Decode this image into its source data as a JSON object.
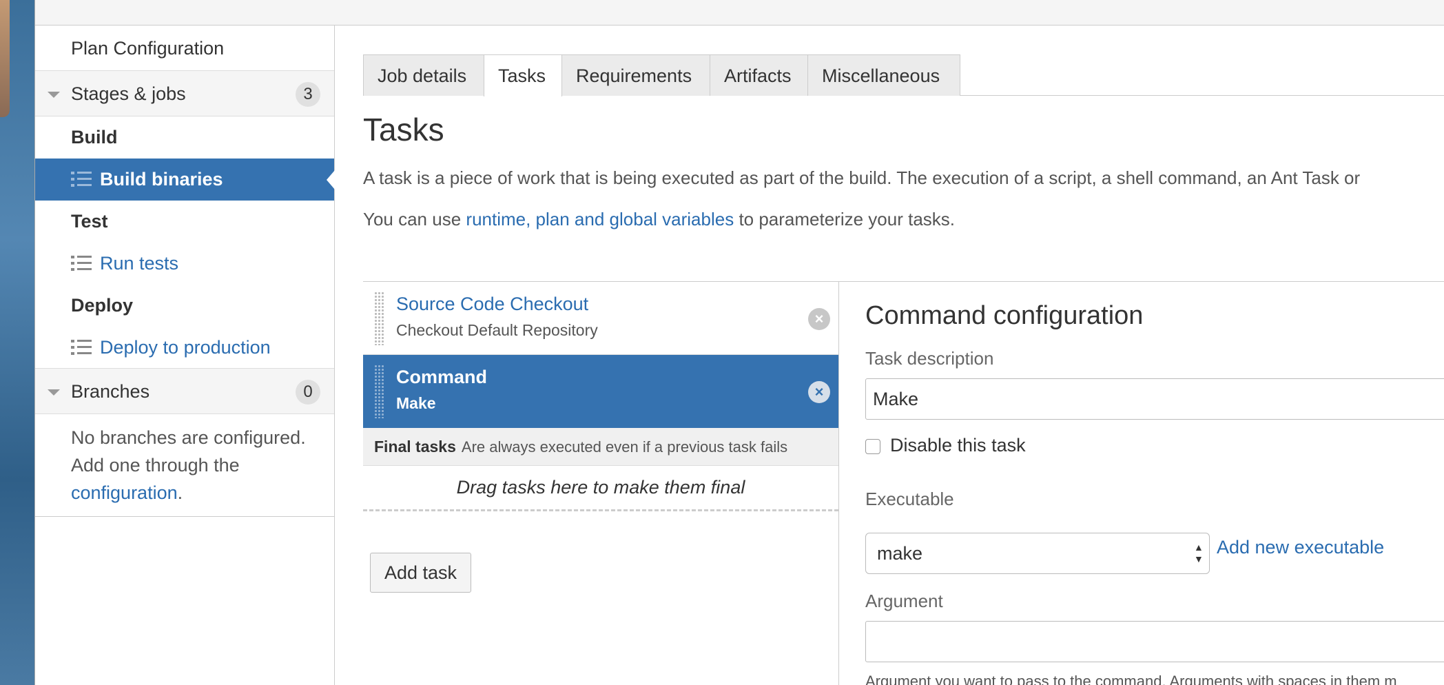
{
  "sidebar": {
    "title": "Plan Configuration",
    "stages_section": {
      "label": "Stages & jobs",
      "count": "3"
    },
    "stages": [
      {
        "name": "Build",
        "job": "Build binaries"
      },
      {
        "name": "Test",
        "job": "Run tests"
      },
      {
        "name": "Deploy",
        "job": "Deploy to production"
      }
    ],
    "branches_section": {
      "label": "Branches",
      "count": "0"
    },
    "branches_note": {
      "text": "No branches are configured. Add one through the",
      "link": "configuration",
      "suffix": "."
    }
  },
  "tabs": [
    "Job details",
    "Tasks",
    "Requirements",
    "Artifacts",
    "Miscellaneous"
  ],
  "active_tab": "Tasks",
  "page": {
    "title": "Tasks",
    "description": "A task is a piece of work that is being executed as part of the build. The execution of a script, a shell command, an Ant Task or",
    "vars_prefix": "You can use",
    "vars_link": "runtime, plan and global variables",
    "vars_suffix": "to parameterize your tasks."
  },
  "tasks": [
    {
      "title": "Source Code Checkout",
      "subtitle": "Checkout Default Repository",
      "selected": false
    },
    {
      "title": "Command",
      "subtitle": "Make",
      "selected": true
    }
  ],
  "final_tasks": {
    "label": "Final tasks",
    "description": "Are always executed even if a previous task fails",
    "drop_text": "Drag tasks here to make them final"
  },
  "add_task_label": "Add task",
  "config": {
    "title": "Command configuration",
    "task_description_label": "Task description",
    "task_description_value": "Make",
    "disable_label": "Disable this task",
    "executable_label": "Executable",
    "executable_value": "make",
    "add_executable_label": "Add new executable",
    "argument_label": "Argument",
    "argument_value": "",
    "argument_help": "Argument you want to pass to the command. Arguments with spaces in them m"
  },
  "colors": {
    "accent": "#3572b0",
    "link": "#2a6cb0"
  }
}
